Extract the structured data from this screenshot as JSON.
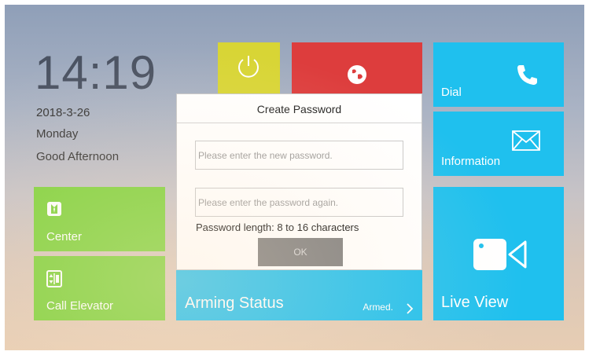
{
  "status": {
    "time": "14:19",
    "date": "2018-3-26",
    "weekday": "Monday",
    "greeting": "Good Afternoon"
  },
  "tiles": {
    "center": {
      "label": "Center",
      "icon": "person-icon"
    },
    "call_elevator": {
      "label": "Call Elevator",
      "icon": "elevator-icon"
    },
    "power": {
      "icon": "power-icon"
    },
    "ip": {
      "icon": "globe-icon"
    },
    "arming": {
      "label": "Arming Status",
      "status": "Armed."
    },
    "dial": {
      "label": "Dial",
      "icon": "phone-icon"
    },
    "information": {
      "label": "Information",
      "icon": "envelope-icon"
    },
    "live_view": {
      "label": "Live View",
      "icon": "camera-icon"
    }
  },
  "dialog": {
    "title": "Create Password",
    "new_password_placeholder": "Please enter the new password.",
    "confirm_password_placeholder": "Please enter the password again.",
    "new_password_value": "",
    "confirm_password_value": "",
    "hint": "Password length: 8 to 16 characters",
    "ok_label": "OK"
  },
  "colors": {
    "green": "#7ed23a",
    "cyan": "#1fc0ee",
    "yellow": "#d8d535",
    "red": "#dd3d3d",
    "button_disabled": "#7e7e7e"
  }
}
